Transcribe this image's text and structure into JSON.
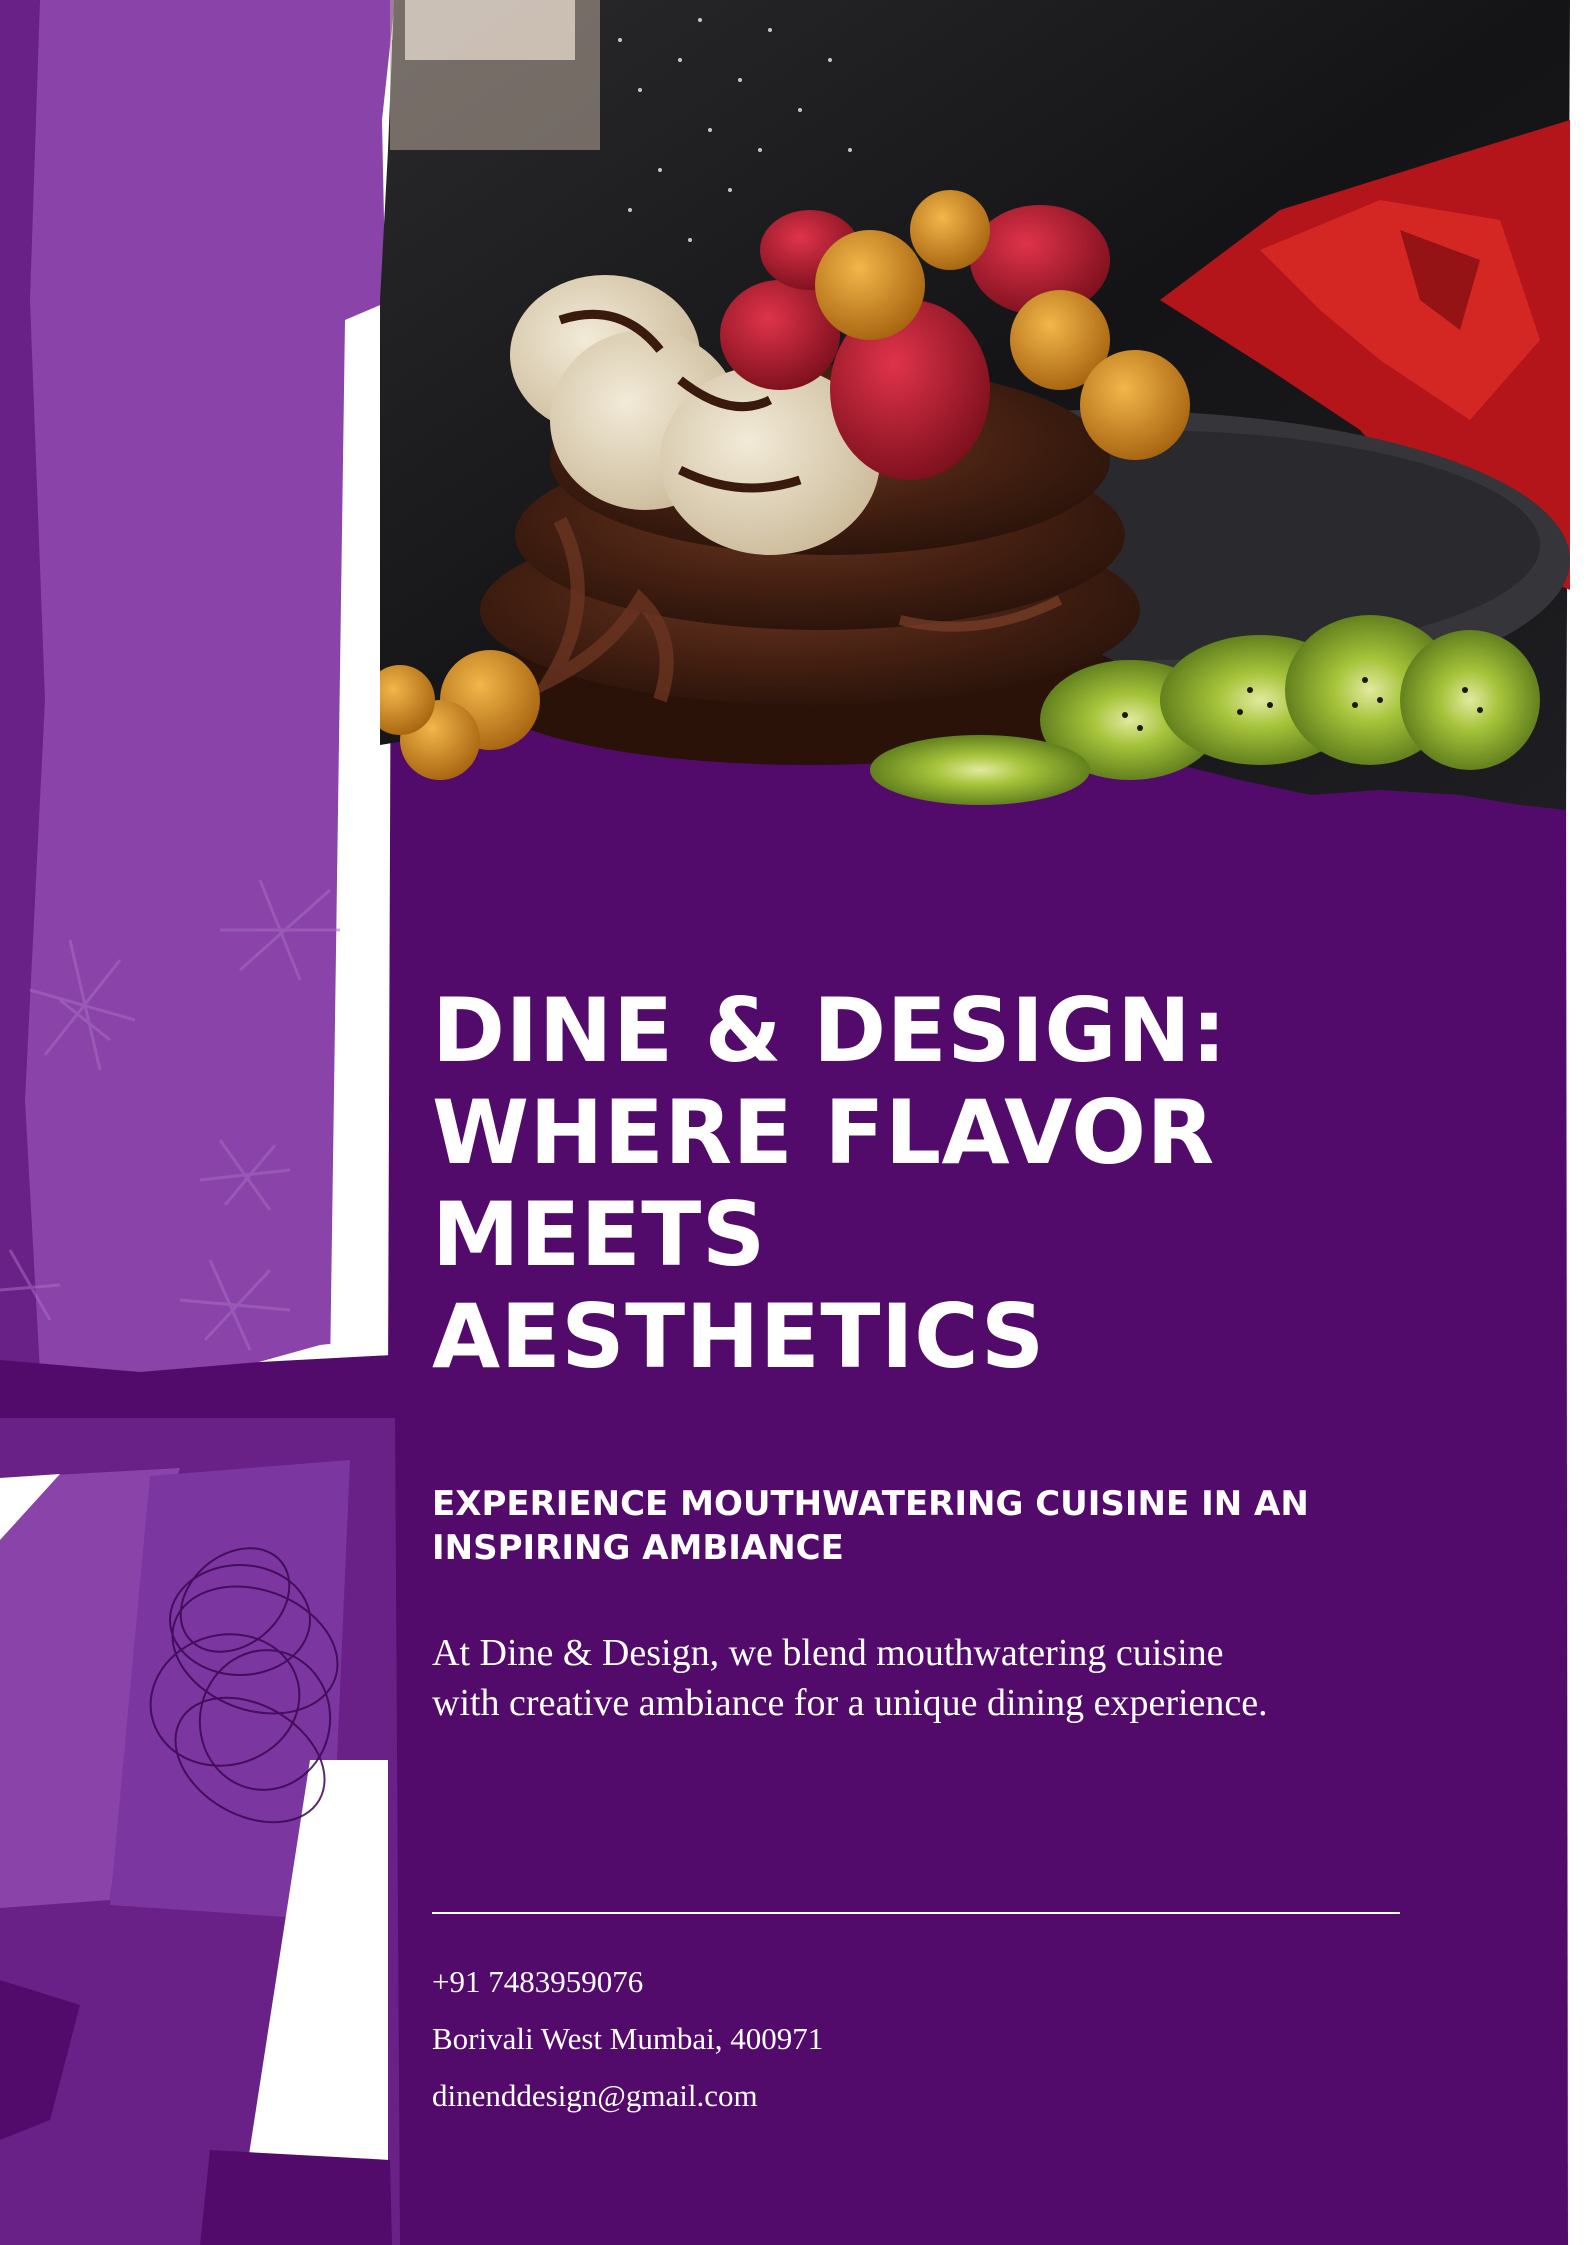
{
  "colors": {
    "panel": "#520b6b",
    "light_purple": "#8a43a8",
    "mid_purple": "#6a2187",
    "text": "#ffffff"
  },
  "photo": {
    "subject": "chocolate-pancake-stack-with-fruit"
  },
  "headline": {
    "line1": "DINE & DESIGN:",
    "line2": "WHERE FLAVOR",
    "line3": "MEETS",
    "line4": "AESTHETICS"
  },
  "subheading": {
    "line1": "EXPERIENCE MOUTHWATERING CUISINE IN AN",
    "line2": "INSPIRING AMBIANCE"
  },
  "description": {
    "line1": "At Dine & Design, we blend mouthwatering cuisine",
    "line2": "with creative ambiance for a unique dining experience."
  },
  "contact": {
    "phone": "+91 7483959076",
    "address": "Borivali West Mumbai, 400971",
    "email": "dinenddesign@gmail.com"
  }
}
